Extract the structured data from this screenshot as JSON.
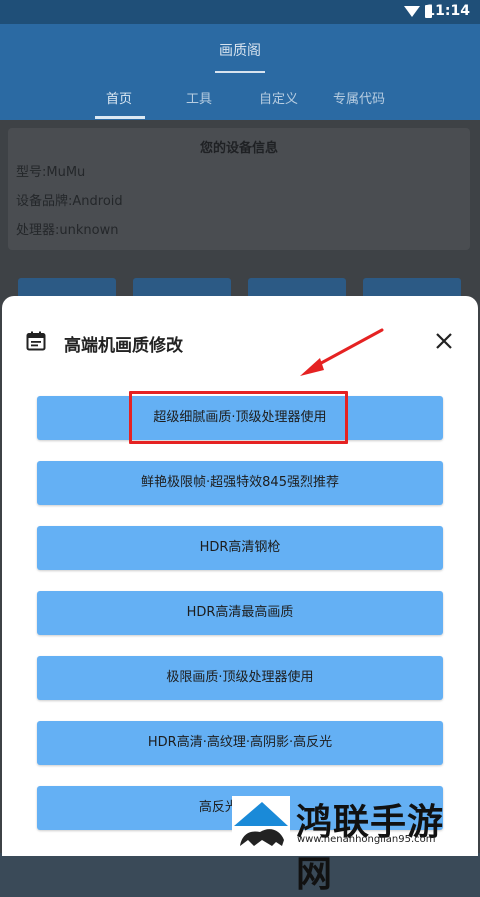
{
  "status_bar": {
    "time": "11:14"
  },
  "app": {
    "title": "画质阁",
    "tabs": [
      {
        "label": "首页",
        "active": true
      },
      {
        "label": "工具",
        "active": false
      },
      {
        "label": "自定义",
        "active": false
      },
      {
        "label": "专属代码",
        "active": false
      }
    ]
  },
  "device_info": {
    "title": "您的设备信息",
    "model": "型号:MuMu",
    "brand": "设备品牌:Android",
    "processor": "处理器:unknown"
  },
  "sheet": {
    "title": "高端机画质修改",
    "icon": "calendar-icon",
    "close_icon": "close-icon",
    "options": [
      "超级细腻画质·顶级处理器使用",
      "鲜艳极限帧·超强特效845强烈推荐",
      "HDR高清钢枪",
      "HDR高清最高画质",
      "极限画质·顶级处理器使用",
      "HDR高清·高纹理·高阴影·高反光",
      "高反光·高远视"
    ]
  },
  "annotation": {
    "color": "#e52222"
  },
  "watermark": {
    "text": "鸿联手游网",
    "url": "www.henanhonglian95.com"
  },
  "colors": {
    "primary": "#2b6aa3",
    "button": "#64b0f4",
    "highlight": "#e52222"
  }
}
